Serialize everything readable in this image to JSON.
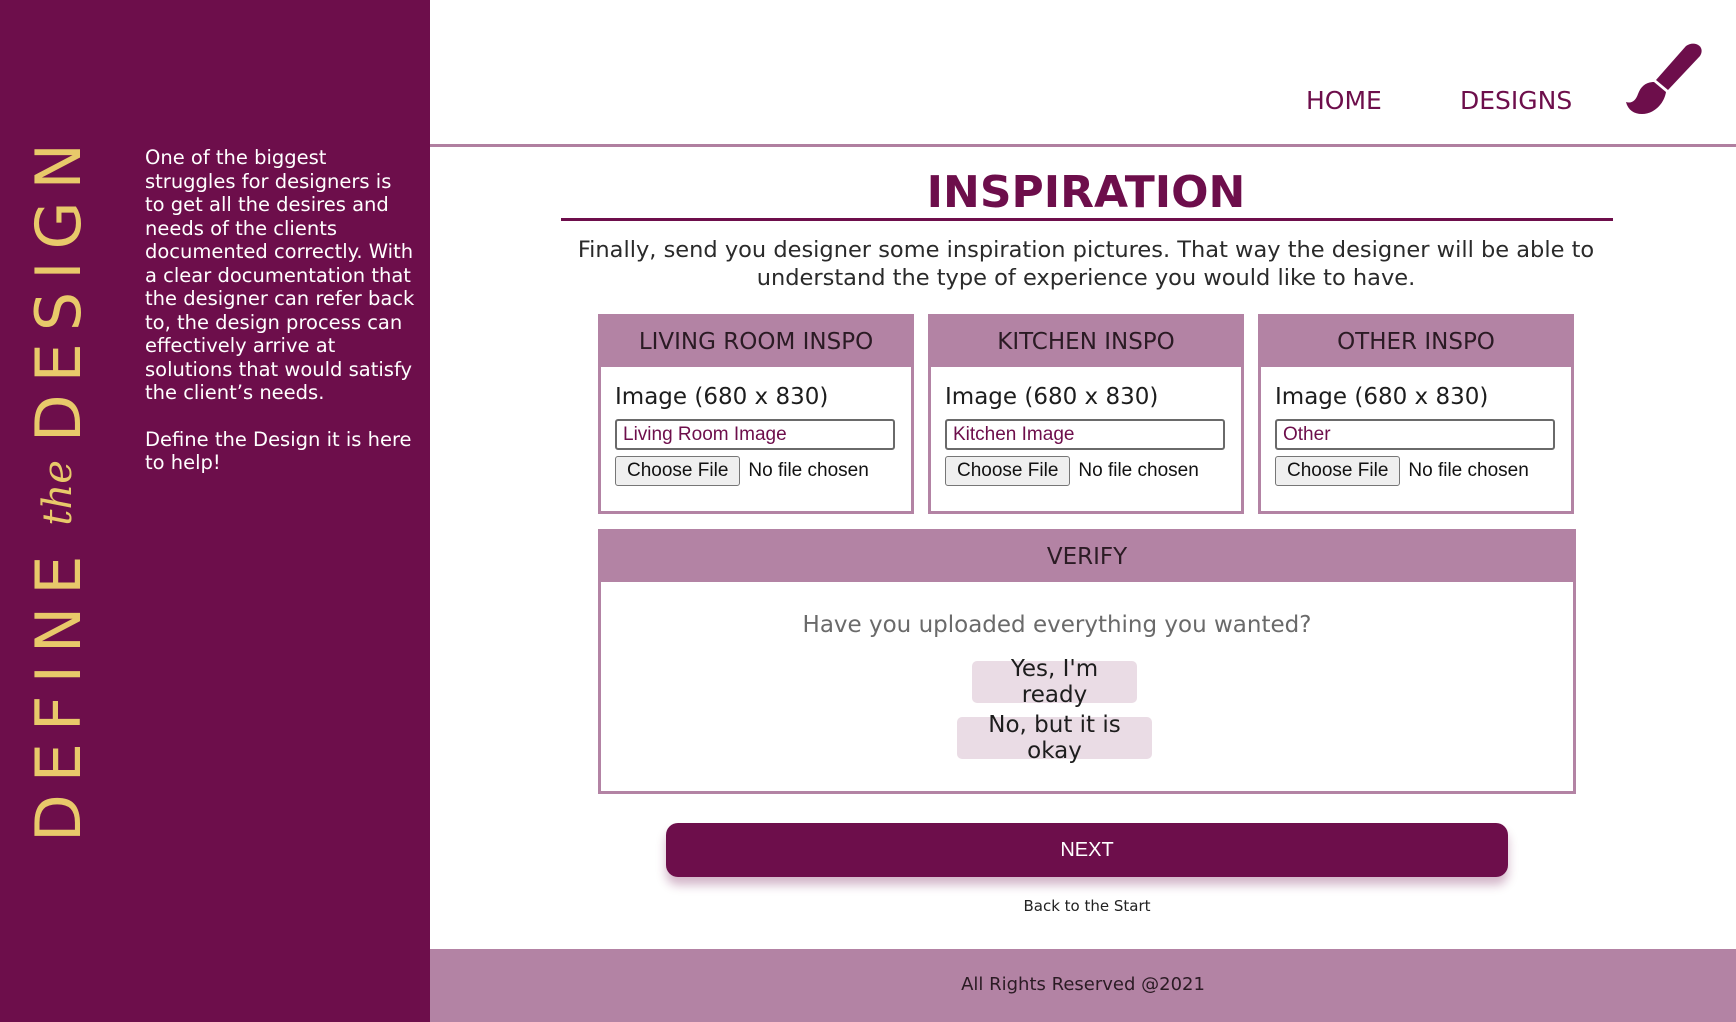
{
  "brand": {
    "logo_word_1": "DEFINE",
    "logo_word_2": "the",
    "logo_word_3": "DESIGN",
    "colors": {
      "primary": "#6d0e4b",
      "accent": "#e8c96a",
      "muted": "#b383a4",
      "choice_bg": "#eadce5"
    }
  },
  "sidebar": {
    "paragraph_1": "One of the biggest struggles for designers is to get all the desires and needs of the clients documented correctly. With a clear documentation that the designer can refer back to, the design process can effectively arrive at solutions that would satisfy the client’s needs.",
    "paragraph_2": "Define the Design it is here to help!"
  },
  "nav": {
    "home": "HOME",
    "designs": "DESIGNS",
    "icon": "paintbrush-icon"
  },
  "main": {
    "title": "INSPIRATION",
    "intro": "Finally, send you designer some inspiration pictures. That way the designer will be able to understand the type of experience you would like to have."
  },
  "cards": [
    {
      "header": "LIVING ROOM INSPO",
      "label": "Image (680 x 830)",
      "input_value": "Living Room Image",
      "file_button": "Choose File",
      "file_status": "No file chosen"
    },
    {
      "header": "KITCHEN INSPO",
      "label": "Image (680 x 830)",
      "input_value": "Kitchen Image",
      "file_button": "Choose File",
      "file_status": "No file chosen"
    },
    {
      "header": "OTHER INSPO",
      "label": "Image (680 x 830)",
      "input_value": "Other",
      "file_button": "Choose File",
      "file_status": "No file chosen"
    }
  ],
  "verify": {
    "header": "VERIFY",
    "question": "Have you uploaded everything you wanted?",
    "yes": "Yes, I'm ready",
    "no": "No, but it is okay"
  },
  "actions": {
    "next": "NEXT",
    "back": "Back to the Start"
  },
  "footer": {
    "text": "All Rights Reserved @2021"
  }
}
